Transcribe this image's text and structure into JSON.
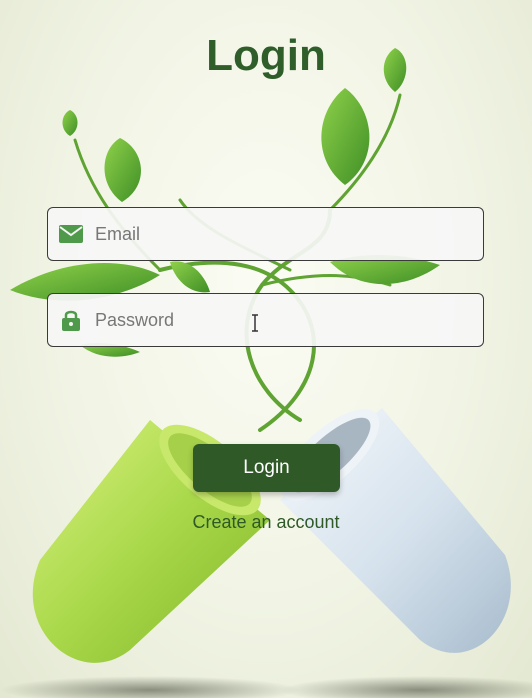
{
  "page": {
    "title": "Login"
  },
  "form": {
    "email": {
      "placeholder": "Email",
      "value": "",
      "icon": "mail-icon"
    },
    "password": {
      "placeholder": "Password",
      "value": "",
      "icon": "lock-icon"
    },
    "login_button": "Login",
    "create_account_link": "Create an account"
  },
  "colors": {
    "primary": "#2f5a27",
    "title": "#2f5e2a",
    "icon": "#4f9a4a",
    "field_border": "#3a3a3a",
    "capsule_green": "#b6e05a",
    "capsule_white": "#dde8f2"
  }
}
